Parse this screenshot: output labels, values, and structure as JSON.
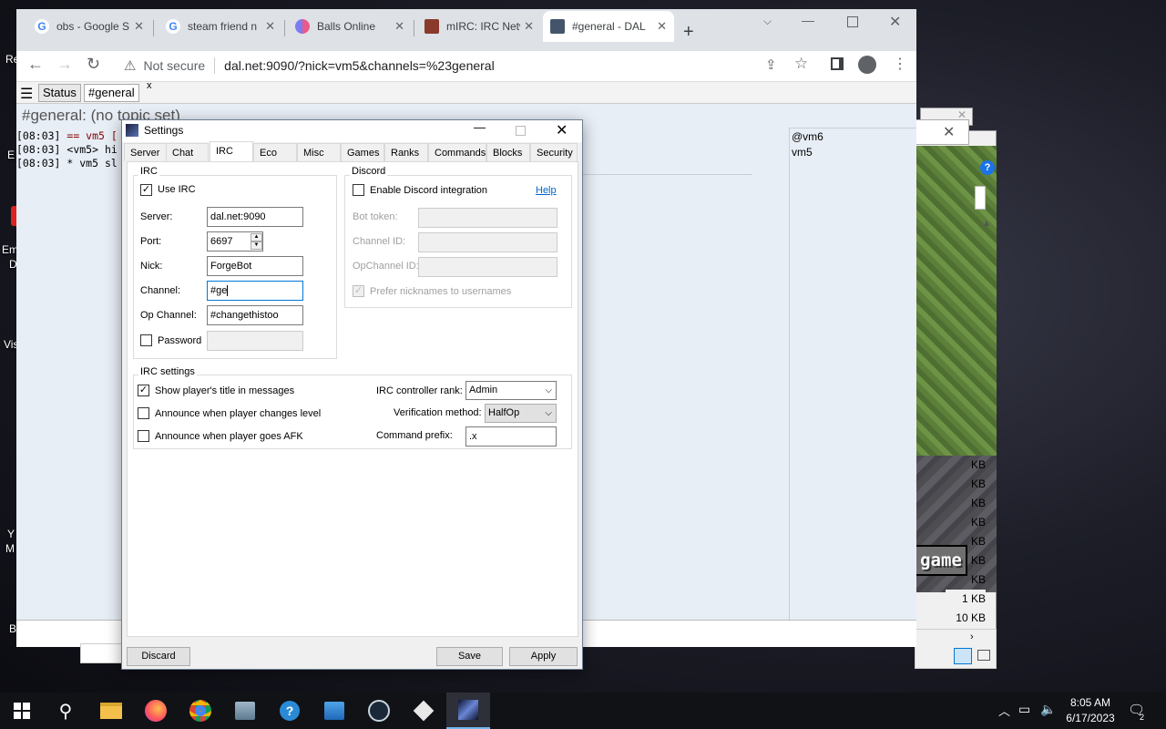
{
  "desktop": {
    "labels": [
      "Re",
      "E",
      "Em",
      "D",
      "Vis",
      "Y",
      "M",
      "B"
    ]
  },
  "browser": {
    "tabs": [
      {
        "title": "obs - Google S",
        "fav": "G",
        "fav_color": "#4285f4"
      },
      {
        "title": "steam friend n",
        "fav": "G",
        "fav_color": "#4285f4"
      },
      {
        "title": "Balls Online",
        "fav": "",
        "fav_color": "#d24a8e"
      },
      {
        "title": "mIRC: IRC Netw",
        "fav": "",
        "fav_color": "#8a3a2b"
      },
      {
        "title": "#general - DAL",
        "fav": "",
        "fav_color": "#44556b"
      }
    ],
    "security_label": "Not secure",
    "url": "dal.net:9090/?nick=vm5&channels=%23general"
  },
  "irc": {
    "status_tab": "Status",
    "channel_tab": "#general",
    "close_glyph": "x",
    "topic": "#general: (no topic set)",
    "messages": [
      {
        "time": "[08:03]",
        "text": "== vm5 ["
      },
      {
        "time": "[08:03]",
        "text": "<vm5> hi"
      },
      {
        "time": "[08:03]",
        "text": "* vm5 sl"
      }
    ],
    "nicks": [
      "@vm6",
      "vm5"
    ]
  },
  "game": {
    "button_label": "game",
    "sizes": [
      "KB",
      "KB",
      "KB",
      "KB",
      "KB",
      "KB",
      "KB",
      "1 KB",
      "10 KB"
    ]
  },
  "settings": {
    "title": "Settings",
    "tabs": [
      "Server",
      "Chat",
      "IRC",
      "Eco",
      "Misc",
      "Games",
      "Ranks",
      "Commands",
      "Blocks",
      "Security"
    ],
    "active_tab": "IRC",
    "irc_group": {
      "title": "IRC",
      "use_irc_label": "Use IRC",
      "use_irc_checked": true,
      "server_label": "Server:",
      "server_value": "dal.net:9090",
      "port_label": "Port:",
      "port_value": "6697",
      "nick_label": "Nick:",
      "nick_value": "ForgeBot",
      "channel_label": "Channel:",
      "channel_value": "#ge",
      "opchannel_label": "Op Channel:",
      "opchannel_value": "#changethistoo",
      "password_label": "Password",
      "password_checked": false
    },
    "discord_group": {
      "title": "Discord",
      "enable_label": "Enable Discord integration",
      "enable_checked": false,
      "help_label": "Help",
      "bot_token_label": "Bot token:",
      "channel_id_label": "Channel ID:",
      "opchannel_id_label": "OpChannel ID:",
      "prefer_label": "Prefer nicknames to usernames",
      "prefer_checked": true
    },
    "irc_settings_group": {
      "title": "IRC settings",
      "show_title_label": "Show player's title in messages",
      "show_title_checked": true,
      "announce_level_label": "Announce when player changes level",
      "announce_level_checked": false,
      "announce_afk_label": "Announce when player goes AFK",
      "announce_afk_checked": false,
      "controller_rank_label": "IRC controller rank:",
      "controller_rank_value": "Admin",
      "verification_label": "Verification method:",
      "verification_value": "HalfOp",
      "command_prefix_label": "Command prefix:",
      "command_prefix_value": ".x"
    },
    "buttons": {
      "discard": "Discard",
      "save": "Save",
      "apply": "Apply"
    }
  },
  "taskbar": {
    "time": "8:05 AM",
    "date": "6/17/2023",
    "notification_count": "2"
  }
}
